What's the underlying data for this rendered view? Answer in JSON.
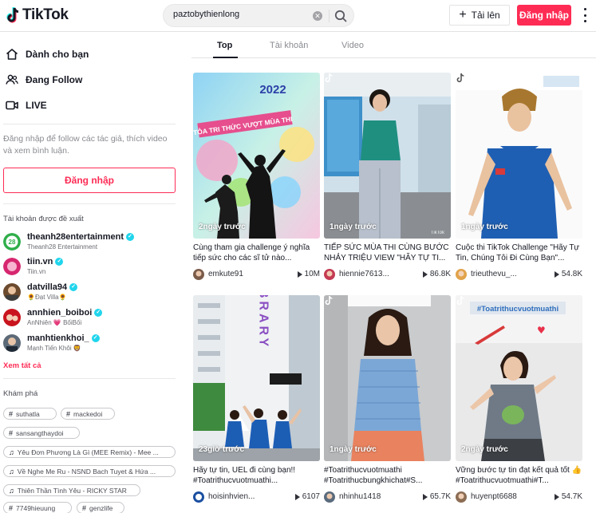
{
  "header": {
    "logo_text": "TikTok",
    "search_value": "paztobythienlong",
    "upload_label": "Tải lên",
    "login_label": "Đăng nhập"
  },
  "sidebar": {
    "nav": [
      {
        "label": "Dành cho bạn",
        "icon": "home-icon"
      },
      {
        "label": "Đang Follow",
        "icon": "users-icon"
      },
      {
        "label": "LIVE",
        "icon": "live-icon"
      }
    ],
    "login_hint": "Đăng nhập để follow các tác giả, thích video và xem bình luận.",
    "login_button": "Đăng nhập",
    "suggested_title": "Tài khoản được đề xuất",
    "accounts": [
      {
        "username": "theanh28entertainment",
        "nickname": "Theanh28 Entertainment",
        "verified": true
      },
      {
        "username": "tiin.vn",
        "nickname": "Tiin.vn",
        "verified": true
      },
      {
        "username": "datvilla94",
        "nickname": "🌻Đạt Villa🌻",
        "verified": true
      },
      {
        "username": "annhien_boiboi",
        "nickname": "AnNhiên 💗 BốiBối",
        "verified": true
      },
      {
        "username": "manhtienkhoi_",
        "nickname": "Mạnh Tiến Khôi 🦁",
        "verified": true
      }
    ],
    "see_all": "Xem tất cả",
    "discover_title": "Khám phá",
    "tags": [
      {
        "text": "suthatla",
        "type": "hashtag"
      },
      {
        "text": "mackedoi",
        "type": "hashtag"
      },
      {
        "text": "sansangthaydoi",
        "type": "hashtag"
      },
      {
        "text": "Yêu Đơn Phương Là Gì (MEE Remix) - Mee ...",
        "type": "music"
      },
      {
        "text": "Về Nghe Me Ru - NSND Bach Tuyet & Hứa ...",
        "type": "music"
      },
      {
        "text": "Thiên Thần Tình Yêu - RICKY STAR",
        "type": "music"
      },
      {
        "text": "7749hieuung",
        "type": "hashtag"
      },
      {
        "text": "genzlife",
        "type": "hashtag"
      }
    ]
  },
  "tabs": [
    "Top",
    "Tài khoản",
    "Video"
  ],
  "videos": [
    {
      "when": "2ngày trước",
      "caption": "Cùng tham gia challenge ý nghĩa tiếp sức cho các sĩ tử nào...",
      "author": "emkute91",
      "plays": "10M"
    },
    {
      "when": "1ngày trước",
      "caption": "TIẾP SỨC MÙA THI CÙNG BƯỚC NHẢY TRIỆU VIEW \"HÃY TỰ TI...",
      "author": "hiennie7613...",
      "plays": "86.8K"
    },
    {
      "when": "1ngày trước",
      "caption": "Cuộc thi TikTok Challenge \"Hãy Tự Tin, Chúng Tôi Đi Cùng Bạn\"...",
      "author": "trieuthevu_...",
      "plays": "54.8K"
    },
    {
      "when": "23giờ trước",
      "caption": "Hãy tự tin, UEL đi cùng bạn!! #Toatrithucvuotmuathi...",
      "author": "hoisinhvien...",
      "plays": "6107"
    },
    {
      "when": "1ngày trước",
      "caption": "#Toatrithucvuotmuathi #Toatrithucbungkhichat#S...",
      "author": "nhinhu1418",
      "plays": "65.7K"
    },
    {
      "when": "2ngày trước",
      "caption": "Vững bước tự tin đạt kết quả tốt 👍#Toatrithucvuotmuathi#T...",
      "author": "huyenpt6688",
      "plays": "54.7K"
    }
  ],
  "thumb_texts": {
    "poster_year": "2022",
    "poster_banner": "TỎA TRI THỨC VƯỢT MÙA THI",
    "library_letters": "BRARY",
    "hashtag_banner": "#Toatrithucvuotmuathi",
    "watermark": "TikTok"
  },
  "colors": {
    "accent": "#fe2c55",
    "verified": "#20d5ec"
  }
}
